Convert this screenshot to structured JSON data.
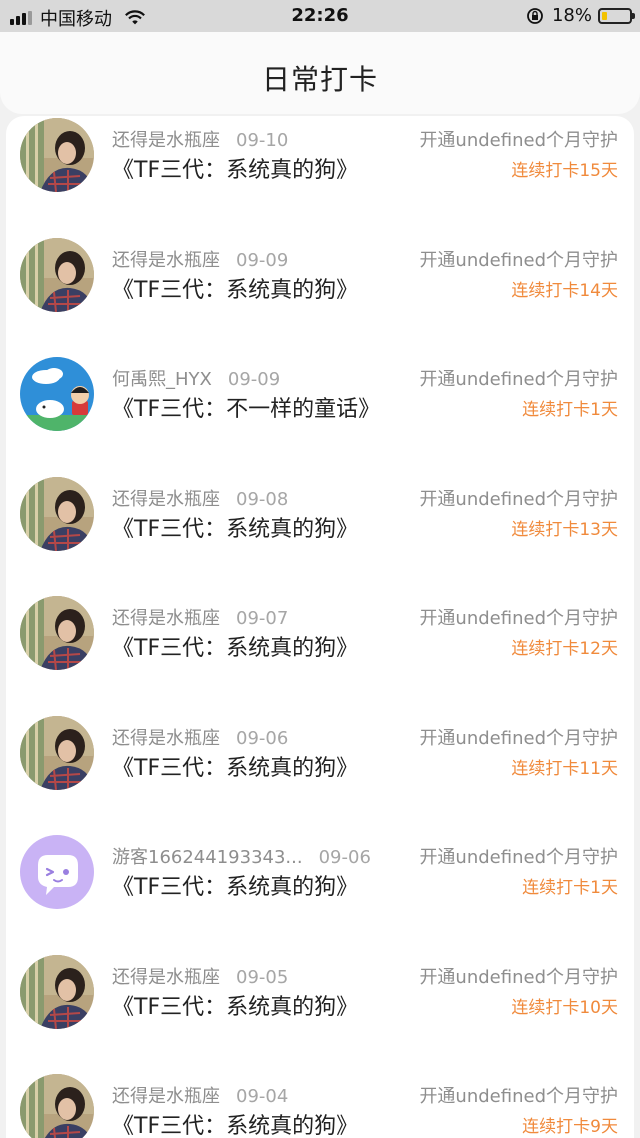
{
  "status_bar": {
    "carrier": "中国移动",
    "time": "22:26",
    "battery": "18%",
    "battery_level": 0.18
  },
  "header": {
    "title": "日常打卡"
  },
  "checkins": [
    {
      "user": "还得是水瓶座",
      "date": "09-10",
      "book": "《TF三代：系统真的狗》",
      "plan": "开通undefined个月守护",
      "streak": "连续打卡15天",
      "avatar": "photo-avatar"
    },
    {
      "user": "还得是水瓶座",
      "date": "09-09",
      "book": "《TF三代：系统真的狗》",
      "plan": "开通undefined个月守护",
      "streak": "连续打卡14天",
      "avatar": "photo-avatar"
    },
    {
      "user": "何禹熙_HYX",
      "date": "09-09",
      "book": "《TF三代：不一样的童话》",
      "plan": "开通undefined个月守护",
      "streak": "连续打卡1天",
      "avatar": "cartoon-avatar"
    },
    {
      "user": "还得是水瓶座",
      "date": "09-08",
      "book": "《TF三代：系统真的狗》",
      "plan": "开通undefined个月守护",
      "streak": "连续打卡13天",
      "avatar": "photo-avatar"
    },
    {
      "user": "还得是水瓶座",
      "date": "09-07",
      "book": "《TF三代：系统真的狗》",
      "plan": "开通undefined个月守护",
      "streak": "连续打卡12天",
      "avatar": "photo-avatar"
    },
    {
      "user": "还得是水瓶座",
      "date": "09-06",
      "book": "《TF三代：系统真的狗》",
      "plan": "开通undefined个月守护",
      "streak": "连续打卡11天",
      "avatar": "photo-avatar"
    },
    {
      "user": "游客166244193343...",
      "date": "09-06",
      "book": "《TF三代：系统真的狗》",
      "plan": "开通undefined个月守护",
      "streak": "连续打卡1天",
      "avatar": "guest-avatar"
    },
    {
      "user": "还得是水瓶座",
      "date": "09-05",
      "book": "《TF三代：系统真的狗》",
      "plan": "开通undefined个月守护",
      "streak": "连续打卡10天",
      "avatar": "photo-avatar"
    },
    {
      "user": "还得是水瓶座",
      "date": "09-04",
      "book": "《TF三代：系统真的狗》",
      "plan": "开通undefined个月守护",
      "streak": "连续打卡9天",
      "avatar": "photo-avatar"
    }
  ],
  "colors": {
    "accent_orange": "#f08a3c",
    "meta_gray": "#8e8e8e",
    "guest_avatar_bg": "#c9b3f5"
  }
}
